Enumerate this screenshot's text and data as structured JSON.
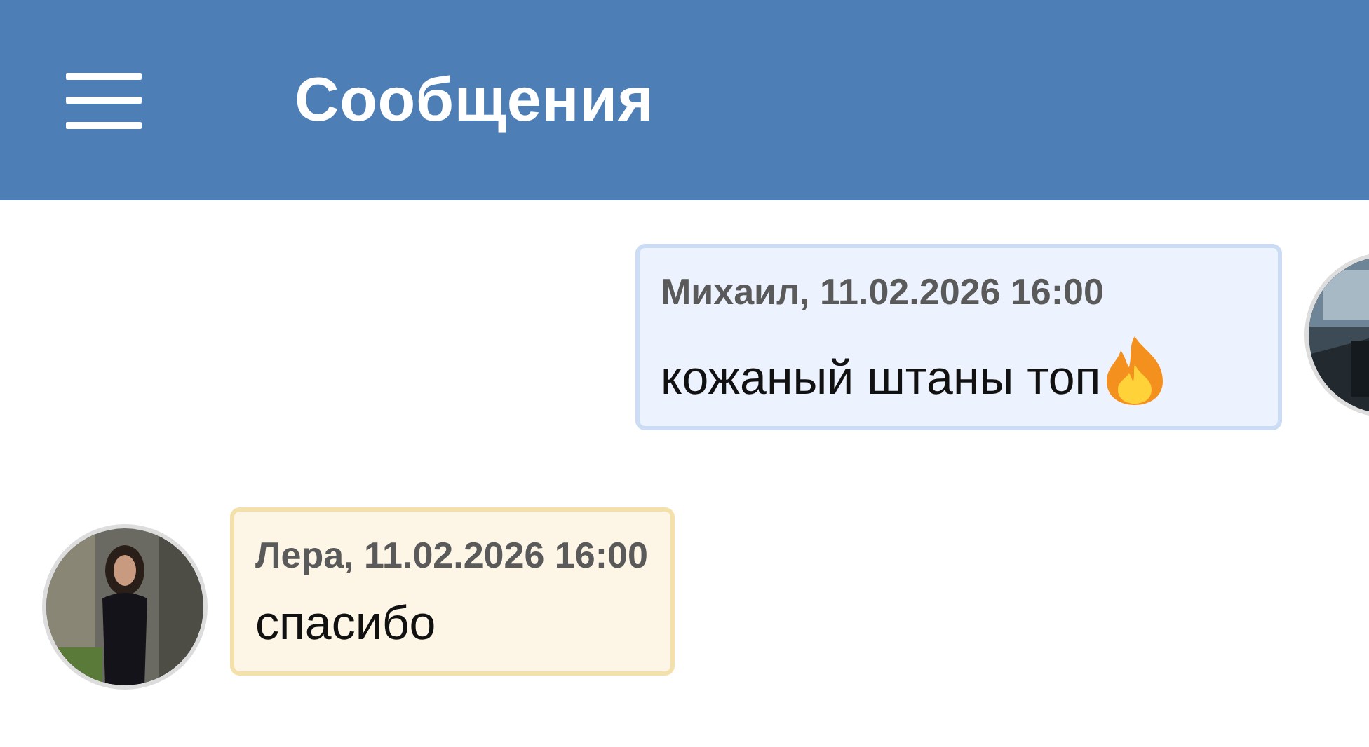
{
  "header": {
    "title": "Сообщения"
  },
  "messages": [
    {
      "kind": "sent",
      "author_line": "Михаил, 11.02.2026 16:00",
      "text": "кожаный штаны топ",
      "trailing_icon": true
    },
    {
      "kind": "received",
      "author_line": "Лера, 11.02.2026 16:00",
      "text": "спасибо",
      "trailing_icon": false
    }
  ]
}
